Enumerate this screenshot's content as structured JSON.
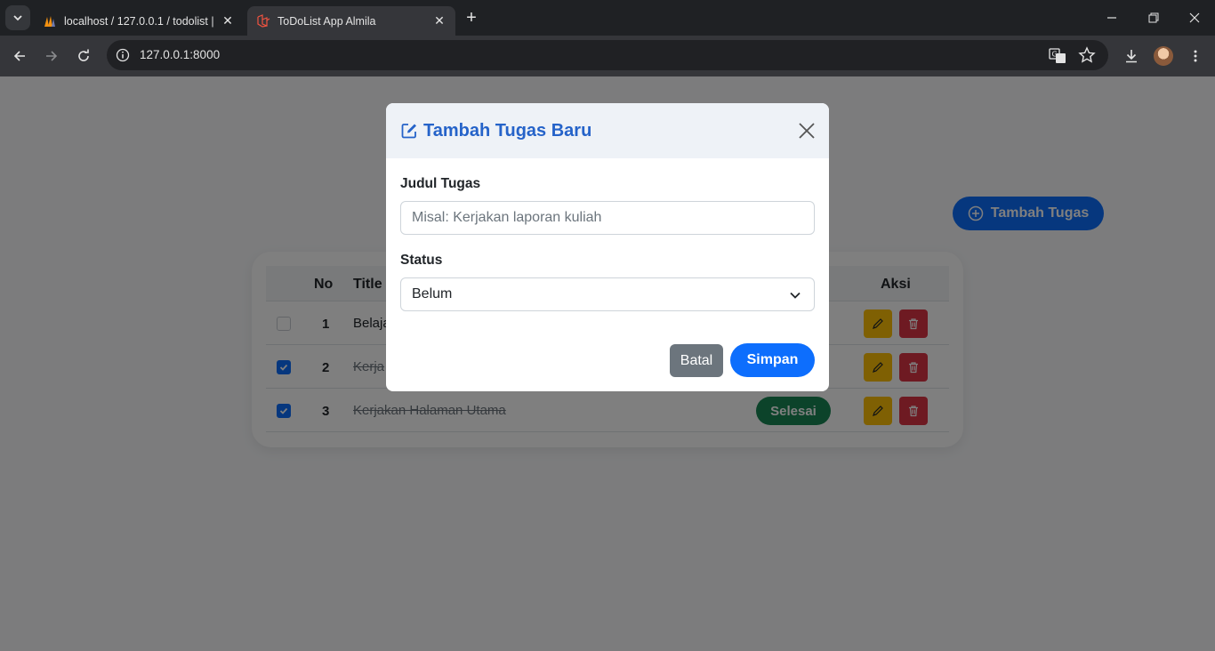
{
  "browser": {
    "tabs": [
      {
        "title": "localhost / 127.0.0.1 / todolist |",
        "active": false
      },
      {
        "title": "ToDoList App Almila",
        "active": true
      }
    ],
    "url": "127.0.0.1:8000"
  },
  "page": {
    "add_button_label": "Tambah Tugas",
    "table": {
      "headers": {
        "no": "No",
        "title": "Title",
        "action": "Aksi"
      },
      "rows": [
        {
          "no": "1",
          "title": "Belaja",
          "checked": false,
          "status": ""
        },
        {
          "no": "2",
          "title": "Kerja",
          "checked": true,
          "status": ""
        },
        {
          "no": "3",
          "title": "Kerjakan Halaman Utama",
          "checked": true,
          "status": "Selesai"
        }
      ]
    }
  },
  "modal": {
    "title": "Tambah Tugas Baru",
    "title_label": "Judul Tugas",
    "title_placeholder": "Misal: Kerjakan laporan kuliah",
    "title_value": "",
    "status_label": "Status",
    "status_selected": "Belum",
    "cancel_label": "Batal",
    "save_label": "Simpan"
  },
  "colors": {
    "primary": "#0d6efd",
    "success": "#198754",
    "warning": "#ffc107",
    "danger": "#dc3545",
    "secondary": "#6c757d",
    "modal_title": "#2563c9"
  }
}
